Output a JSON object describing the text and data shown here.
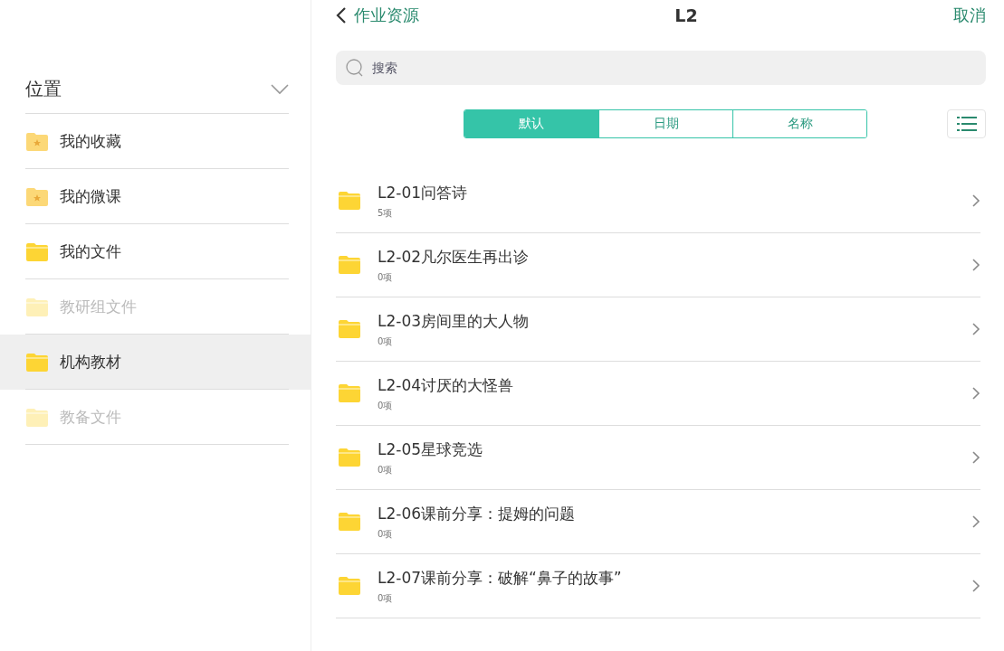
{
  "sidebar": {
    "title": "位置",
    "expanded": true,
    "items": [
      {
        "label": "我的收藏",
        "kind": "starred",
        "disabled": false,
        "selected": false
      },
      {
        "label": "我的微课",
        "kind": "starred",
        "disabled": false,
        "selected": false
      },
      {
        "label": "我的文件",
        "kind": "folder",
        "disabled": false,
        "selected": false
      },
      {
        "label": "教研组文件",
        "kind": "folder",
        "disabled": true,
        "selected": false
      },
      {
        "label": "机构教材",
        "kind": "folder",
        "disabled": false,
        "selected": true
      },
      {
        "label": "教备文件",
        "kind": "folder",
        "disabled": true,
        "selected": false
      }
    ]
  },
  "nav": {
    "back": "作业资源",
    "title": "L2",
    "cancel": "取消"
  },
  "search": {
    "placeholder": "搜索"
  },
  "sort_tabs": [
    {
      "label": "默认",
      "selected": true
    },
    {
      "label": "日期",
      "selected": false
    },
    {
      "label": "名称",
      "selected": false
    }
  ],
  "folders": [
    {
      "name": "L2-01问答诗",
      "count": "5项"
    },
    {
      "name": "L2-02凡尔医生再出诊",
      "count": "0项"
    },
    {
      "name": "L2-03房间里的大人物",
      "count": "0项"
    },
    {
      "name": "L2-04讨厌的大怪兽",
      "count": "0项"
    },
    {
      "name": "L2-05星球竞选",
      "count": "0项"
    },
    {
      "name": "L2-06课前分享：提姆的问题",
      "count": "0项"
    },
    {
      "name": "L2-07课前分享：破解“鼻子的故事”",
      "count": "0项"
    }
  ]
}
